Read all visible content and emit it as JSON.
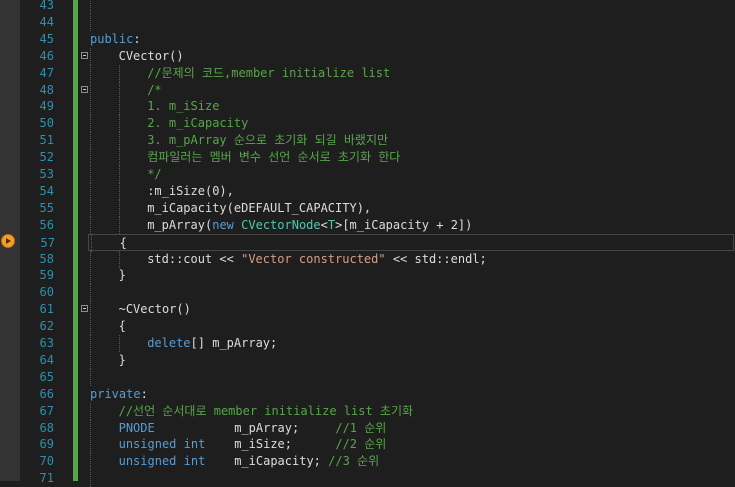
{
  "editor": {
    "current_line": 57,
    "lines": [
      {
        "n": "43",
        "indent": 1,
        "tokens": []
      },
      {
        "n": "44",
        "indent": 1,
        "tokens": []
      },
      {
        "n": "45",
        "indent": 0,
        "tokens": [
          {
            "t": "public",
            "c": "kw"
          },
          {
            "t": ":",
            "c": "pl"
          }
        ]
      },
      {
        "n": "46",
        "indent": 1,
        "fold": true,
        "tokens": [
          {
            "t": "CVector()",
            "c": "pl"
          }
        ]
      },
      {
        "n": "47",
        "indent": 2,
        "tokens": [
          {
            "t": "//문제의 코드,member initialize list",
            "c": "cm"
          }
        ]
      },
      {
        "n": "48",
        "indent": 2,
        "fold": true,
        "tokens": [
          {
            "t": "/*",
            "c": "cm"
          }
        ]
      },
      {
        "n": "49",
        "indent": 2,
        "tokens": [
          {
            "t": "1. m_iSize",
            "c": "cm"
          }
        ]
      },
      {
        "n": "50",
        "indent": 2,
        "tokens": [
          {
            "t": "2. m_iCapacity",
            "c": "cm"
          }
        ]
      },
      {
        "n": "51",
        "indent": 2,
        "tokens": [
          {
            "t": "3. m_pArray 순으로 초기화 되길 바랬지만",
            "c": "cm"
          }
        ]
      },
      {
        "n": "52",
        "indent": 2,
        "tokens": [
          {
            "t": "컴파일러는 멤버 변수 선언 순서로 초기화 한다",
            "c": "cm"
          }
        ]
      },
      {
        "n": "53",
        "indent": 2,
        "tokens": [
          {
            "t": "*/",
            "c": "cm"
          }
        ]
      },
      {
        "n": "54",
        "indent": 2,
        "tokens": [
          {
            "t": ":m_iSize(0),",
            "c": "pl"
          }
        ]
      },
      {
        "n": "55",
        "indent": 2,
        "tokens": [
          {
            "t": "m_iCapacity(eDEFAULT_CAPACITY),",
            "c": "pl"
          }
        ]
      },
      {
        "n": "56",
        "indent": 2,
        "tokens": [
          {
            "t": "m_pArray(",
            "c": "pl"
          },
          {
            "t": "new",
            "c": "kw"
          },
          {
            "t": " ",
            "c": "pl"
          },
          {
            "t": "CVectorNode",
            "c": "ty"
          },
          {
            "t": "<",
            "c": "pl"
          },
          {
            "t": "T",
            "c": "ty"
          },
          {
            "t": ">[m_iCapacity + 2])",
            "c": "pl"
          }
        ]
      },
      {
        "n": "57",
        "indent": 1,
        "tokens": [
          {
            "t": "{",
            "c": "pl"
          }
        ]
      },
      {
        "n": "58",
        "indent": 2,
        "tokens": [
          {
            "t": "std::cout << ",
            "c": "pl"
          },
          {
            "t": "\"Vector constructed\"",
            "c": "str"
          },
          {
            "t": " << std::endl;",
            "c": "pl"
          }
        ]
      },
      {
        "n": "59",
        "indent": 1,
        "tokens": [
          {
            "t": "}",
            "c": "pl"
          }
        ]
      },
      {
        "n": "60",
        "indent": 1,
        "tokens": []
      },
      {
        "n": "61",
        "indent": 1,
        "fold": true,
        "tokens": [
          {
            "t": "~CVector()",
            "c": "pl"
          }
        ]
      },
      {
        "n": "62",
        "indent": 1,
        "tokens": [
          {
            "t": "{",
            "c": "pl"
          }
        ]
      },
      {
        "n": "63",
        "indent": 2,
        "tokens": [
          {
            "t": "delete",
            "c": "kw"
          },
          {
            "t": "[] m_pArray;",
            "c": "pl"
          }
        ]
      },
      {
        "n": "64",
        "indent": 1,
        "tokens": [
          {
            "t": "}",
            "c": "pl"
          }
        ]
      },
      {
        "n": "65",
        "indent": 1,
        "tokens": []
      },
      {
        "n": "66",
        "indent": 0,
        "tokens": [
          {
            "t": "private",
            "c": "kw"
          },
          {
            "t": ":",
            "c": "pl"
          }
        ]
      },
      {
        "n": "67",
        "indent": 1,
        "tokens": [
          {
            "t": "//선언 순서대로 member initialize list 초기화",
            "c": "cm"
          }
        ]
      },
      {
        "n": "68",
        "indent": 1,
        "tokens": [
          {
            "t": "PNODE",
            "c": "kw"
          },
          {
            "t": "           m_pArray;     ",
            "c": "pl"
          },
          {
            "t": "//1 순위",
            "c": "cm"
          }
        ]
      },
      {
        "n": "69",
        "indent": 1,
        "tokens": [
          {
            "t": "unsigned",
            "c": "kw"
          },
          {
            "t": " ",
            "c": "pl"
          },
          {
            "t": "int",
            "c": "kw"
          },
          {
            "t": "    m_iSize;      ",
            "c": "pl"
          },
          {
            "t": "//2 순위",
            "c": "cm"
          }
        ]
      },
      {
        "n": "70",
        "indent": 1,
        "tokens": [
          {
            "t": "unsigned",
            "c": "kw"
          },
          {
            "t": " ",
            "c": "pl"
          },
          {
            "t": "int",
            "c": "kw"
          },
          {
            "t": "    m_iCapacity; ",
            "c": "pl"
          },
          {
            "t": "//3 순위",
            "c": "cm"
          }
        ]
      },
      {
        "n": "71",
        "indent": 1,
        "tokens": []
      }
    ]
  }
}
